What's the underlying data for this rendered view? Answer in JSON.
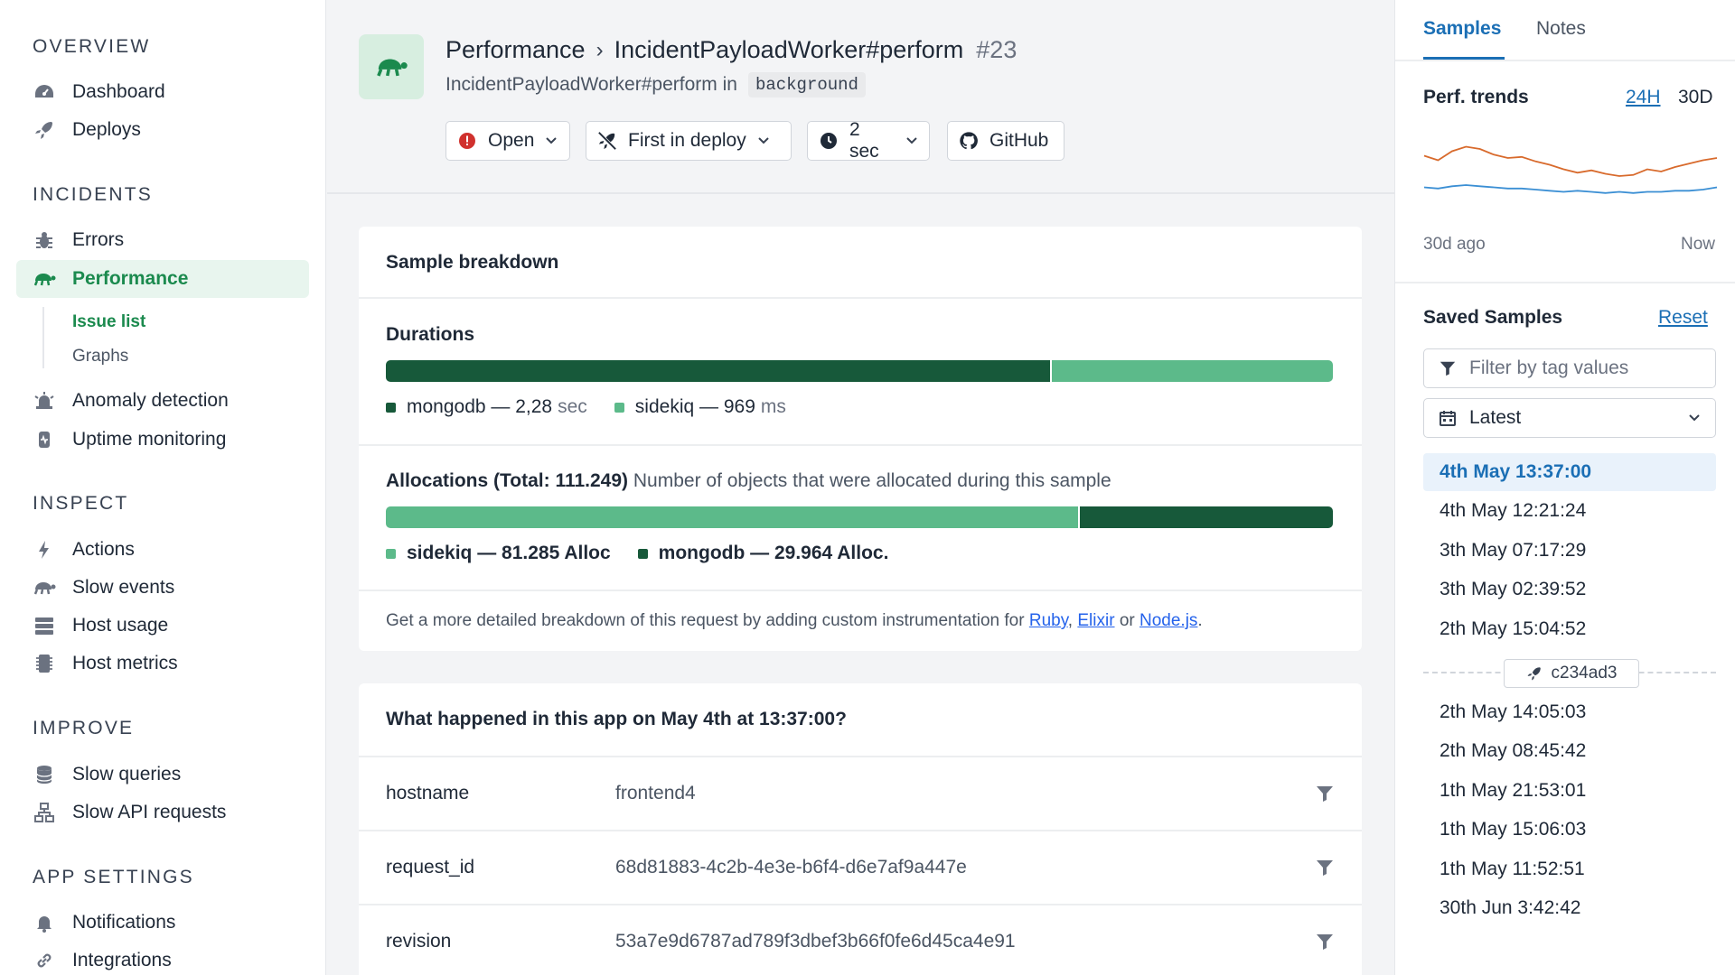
{
  "sidebar": {
    "sections": {
      "overview": "OVERVIEW",
      "incidents": "INCIDENTS",
      "inspect": "INSPECT",
      "improve": "IMPROVE",
      "app_settings": "APP SETTINGS"
    },
    "items": {
      "dashboard": "Dashboard",
      "deploys": "Deploys",
      "errors": "Errors",
      "performance": "Performance",
      "issue_list": "Issue list",
      "graphs": "Graphs",
      "anomaly_detection": "Anomaly detection",
      "uptime_monitoring": "Uptime monitoring",
      "actions": "Actions",
      "slow_events": "Slow events",
      "host_usage": "Host usage",
      "host_metrics": "Host metrics",
      "slow_queries": "Slow queries",
      "slow_api_requests": "Slow API requests",
      "notifications": "Notifications",
      "integrations": "Integrations"
    }
  },
  "header": {
    "breadcrumb_root": "Performance",
    "breadcrumb_sep": "›",
    "breadcrumb_current": "IncidentPayloadWorker#perform",
    "incident_number": "#23",
    "subtitle_prefix": "IncidentPayloadWorker#perform in",
    "namespace": "background",
    "buttons": {
      "state": "Open",
      "first_seen": "First in deploy",
      "duration": "2 sec",
      "github": "GitHub"
    }
  },
  "breakdown": {
    "title": "Sample breakdown",
    "durations_title": "Durations",
    "durations": [
      {
        "name": "mongodb",
        "label": "mongodb — 2,28",
        "unit": "sec",
        "value_ms": 2280,
        "color": "#17593a"
      },
      {
        "name": "sidekiq",
        "label": "sidekiq — 969",
        "unit": "ms",
        "value_ms": 969,
        "color": "#5cba8a"
      }
    ],
    "allocations_title": "Allocations (Total: 111.249)",
    "allocations_desc": "Number of objects that were allocated during this sample",
    "allocations": [
      {
        "name": "sidekiq",
        "label": "sidekiq — 81.285 Alloc",
        "value": 81285,
        "color": "#5cba8a"
      },
      {
        "name": "mongodb",
        "label": "mongodb — 29.964 Alloc.",
        "value": 29964,
        "color": "#17593a"
      }
    ],
    "note_prefix": "Get a more detailed breakdown of this request by adding custom instrumentation for",
    "note_link_ruby": "Ruby",
    "note_comma": ",",
    "note_link_elixir": "Elixir",
    "note_or": "or",
    "note_link_node": "Node.js",
    "note_end": "."
  },
  "happened": {
    "title": "What happened in this app on May 4th at 13:37:00?",
    "rows": [
      {
        "key": "hostname",
        "value": "frontend4"
      },
      {
        "key": "request_id",
        "value": "68d81883-4c2b-4e3e-b6f4-d6e7af9a447e"
      },
      {
        "key": "revision",
        "value": "53a7e9d6787ad789f3dbef3b66f0fe6d45ca4e91"
      }
    ]
  },
  "right_panel": {
    "tabs": {
      "samples": "Samples",
      "notes": "Notes"
    },
    "trends_title": "Perf. trends",
    "range_24h": "24H",
    "range_30d": "30D",
    "axis_start": "30d ago",
    "axis_end": "Now",
    "trend_series": [
      {
        "color": "#d86a2c",
        "values": [
          62,
          58,
          66,
          70,
          68,
          63,
          60,
          61,
          57,
          54,
          50,
          47,
          49,
          46,
          44,
          45,
          50,
          48,
          52,
          55,
          58,
          60
        ]
      },
      {
        "color": "#3b8fd4",
        "values": [
          34,
          33,
          35,
          36,
          35,
          34,
          33,
          33,
          32,
          31,
          30,
          31,
          30,
          29,
          30,
          29,
          30,
          30,
          31,
          31,
          32,
          34
        ]
      }
    ],
    "saved_title": "Saved Samples",
    "reset": "Reset",
    "filter_placeholder": "Filter by tag values",
    "sort_value": "Latest",
    "samples_before": [
      "4th May 13:37:00",
      "4th May 12:21:24",
      "3th May 07:17:29",
      "3th May 02:39:52",
      "2th May 15:04:52"
    ],
    "deploy_marker": "c234ad3",
    "samples_after": [
      "2th May 14:05:03",
      "2th May 08:45:42",
      "1th May 21:53:01",
      "1th May 15:06:03",
      "1th May 11:52:51",
      "30th Jun 3:42:42"
    ]
  }
}
